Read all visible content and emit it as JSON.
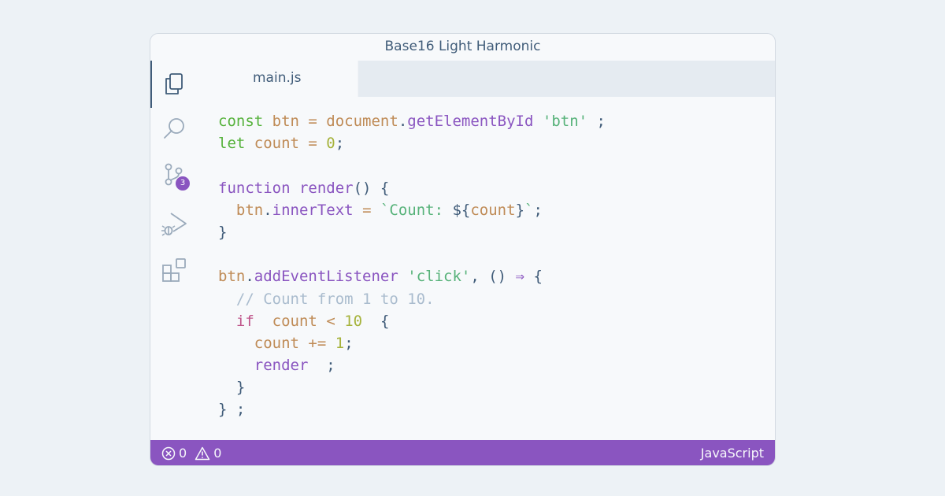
{
  "window": {
    "title": "Base16 Light Harmonic"
  },
  "activity_bar": {
    "items": [
      {
        "icon": "files-icon",
        "active": true
      },
      {
        "icon": "search-icon"
      },
      {
        "icon": "source-control-icon",
        "badge": "3"
      },
      {
        "icon": "run-debug-icon"
      },
      {
        "icon": "extensions-icon"
      }
    ]
  },
  "tabs": [
    {
      "label": "main.js",
      "active": true
    }
  ],
  "editor": {
    "lines": [
      [
        {
          "t": "const ",
          "c": "def"
        },
        {
          "t": "btn",
          "c": "var"
        },
        {
          "t": " = ",
          "c": "var"
        },
        {
          "t": "document",
          "c": "var"
        },
        {
          "t": ".",
          "c": "plain"
        },
        {
          "t": "getElementById",
          "c": "fn"
        },
        {
          "t": " ",
          "c": "plain"
        },
        {
          "t": "'btn'",
          "c": "str"
        },
        {
          "t": " ;",
          "c": "plain"
        }
      ],
      [
        {
          "t": "let ",
          "c": "def"
        },
        {
          "t": "count",
          "c": "var"
        },
        {
          "t": " = ",
          "c": "var"
        },
        {
          "t": "0",
          "c": "num"
        },
        {
          "t": ";",
          "c": "plain"
        }
      ],
      [],
      [
        {
          "t": "function ",
          "c": "kw"
        },
        {
          "t": "render",
          "c": "fn"
        },
        {
          "t": "() {",
          "c": "plain"
        }
      ],
      [
        {
          "t": "  ",
          "c": "plain"
        },
        {
          "t": "btn",
          "c": "var"
        },
        {
          "t": ".",
          "c": "plain"
        },
        {
          "t": "innerText",
          "c": "fn"
        },
        {
          "t": " = ",
          "c": "var"
        },
        {
          "t": "`Count: ",
          "c": "str"
        },
        {
          "t": "${",
          "c": "plain"
        },
        {
          "t": "count",
          "c": "var"
        },
        {
          "t": "}",
          "c": "plain"
        },
        {
          "t": "`",
          "c": "str"
        },
        {
          "t": ";",
          "c": "plain"
        }
      ],
      [
        {
          "t": "}",
          "c": "plain"
        }
      ],
      [],
      [
        {
          "t": "btn",
          "c": "var"
        },
        {
          "t": ".",
          "c": "plain"
        },
        {
          "t": "addEventListener",
          "c": "fn"
        },
        {
          "t": " ",
          "c": "plain"
        },
        {
          "t": "'click'",
          "c": "str"
        },
        {
          "t": ", () ",
          "c": "plain"
        },
        {
          "t": "⇒",
          "c": "kw"
        },
        {
          "t": " {",
          "c": "plain"
        }
      ],
      [
        {
          "t": "  // Count from 1 to 10.",
          "c": "com"
        }
      ],
      [
        {
          "t": "  ",
          "c": "plain"
        },
        {
          "t": "if",
          "c": "if"
        },
        {
          "t": "  ",
          "c": "plain"
        },
        {
          "t": "count",
          "c": "var"
        },
        {
          "t": " < ",
          "c": "var"
        },
        {
          "t": "10",
          "c": "num"
        },
        {
          "t": "  {",
          "c": "plain"
        }
      ],
      [
        {
          "t": "    ",
          "c": "plain"
        },
        {
          "t": "count",
          "c": "var"
        },
        {
          "t": " += ",
          "c": "var"
        },
        {
          "t": "1",
          "c": "num"
        },
        {
          "t": ";",
          "c": "plain"
        }
      ],
      [
        {
          "t": "    ",
          "c": "plain"
        },
        {
          "t": "render",
          "c": "fn"
        },
        {
          "t": "  ;",
          "c": "plain"
        }
      ],
      [
        {
          "t": "  }",
          "c": "plain"
        }
      ],
      [
        {
          "t": "} ;",
          "c": "plain"
        }
      ]
    ]
  },
  "status_bar": {
    "errors": "0",
    "warnings": "0",
    "language": "JavaScript"
  },
  "colors": {
    "background": "#edf2f6",
    "window": "#f7f9fb",
    "tab_strip": "#e5ebf1",
    "status_bar": "#8a55c0",
    "text": "#405c79"
  }
}
